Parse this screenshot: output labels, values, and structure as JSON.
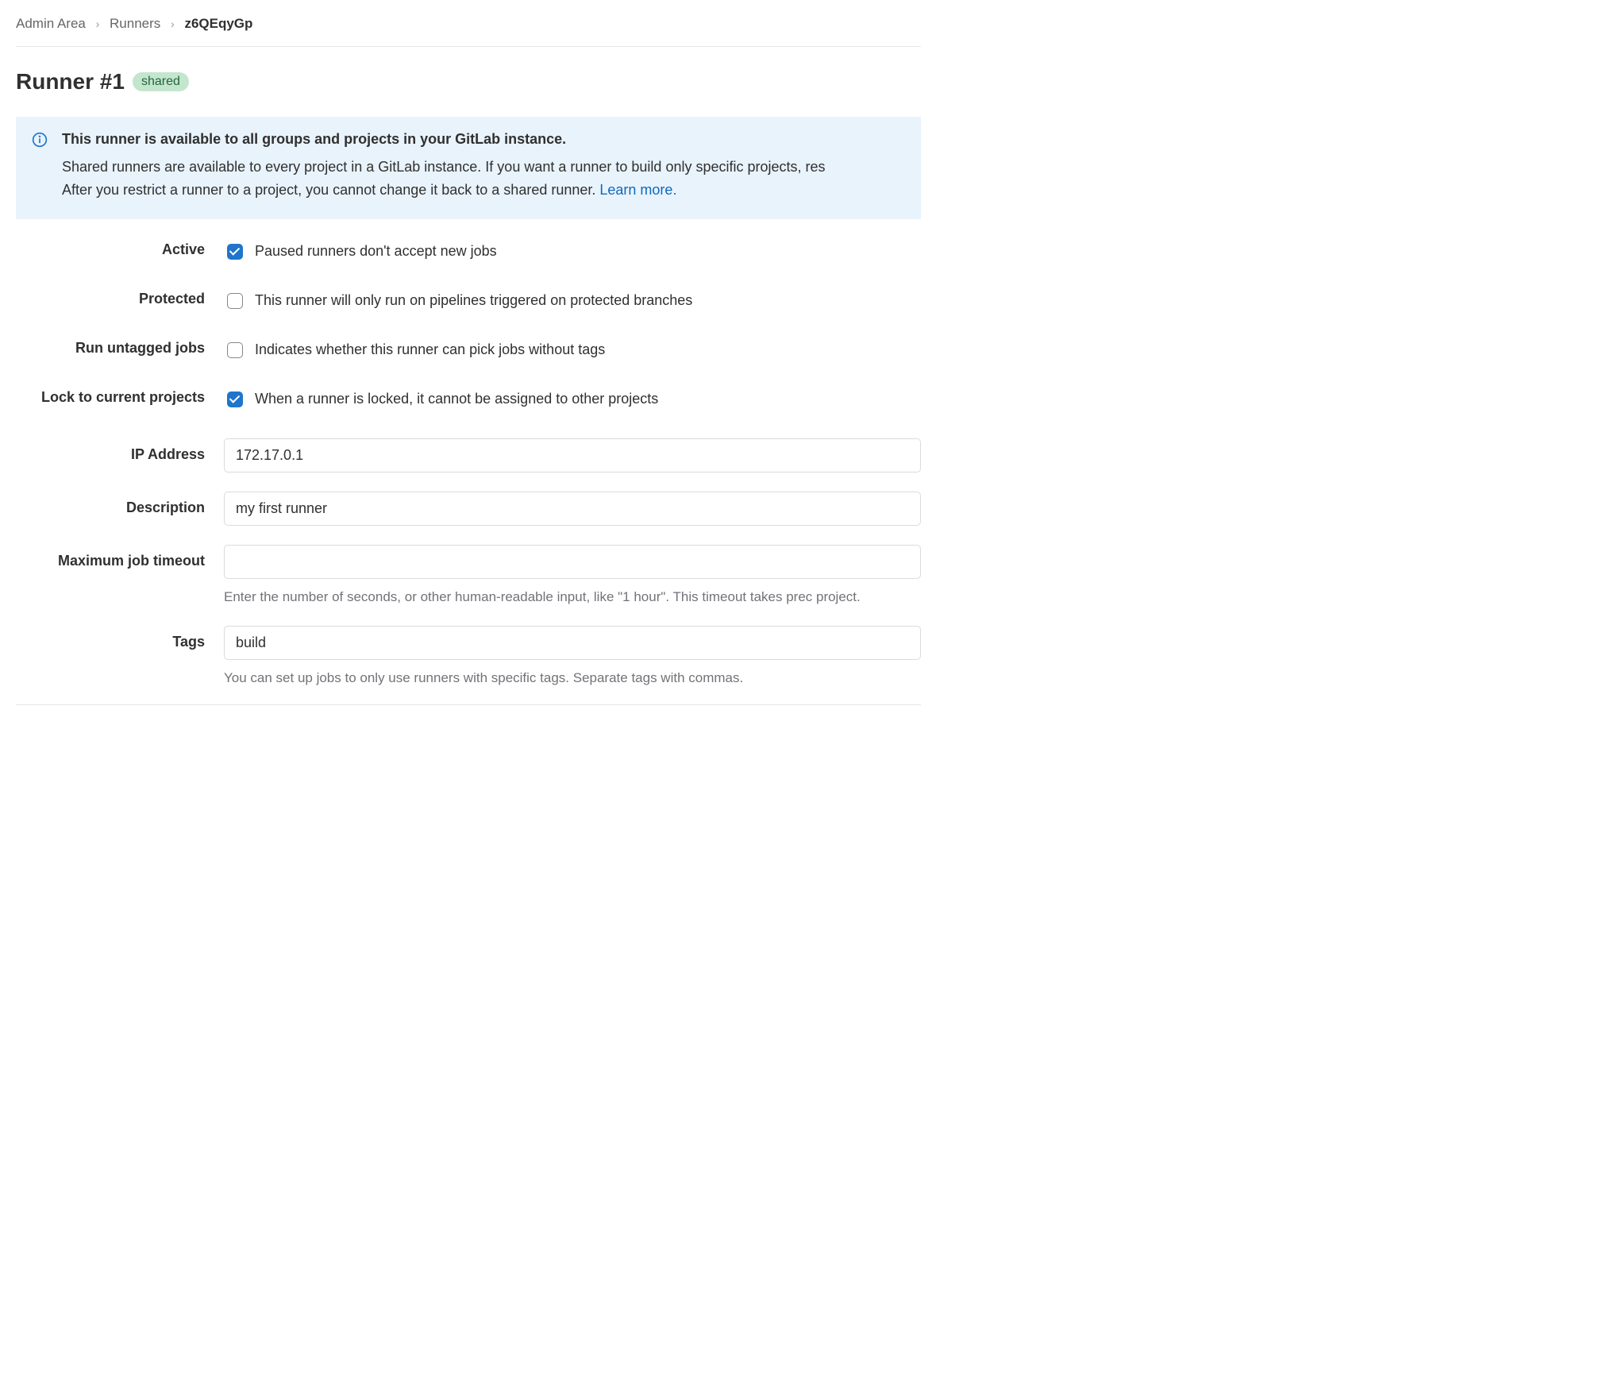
{
  "breadcrumb": {
    "items": [
      "Admin Area",
      "Runners"
    ],
    "current": "z6QEqyGp"
  },
  "header": {
    "title": "Runner #1",
    "badge": "shared"
  },
  "info": {
    "title": "This runner is available to all groups and projects in your GitLab instance.",
    "body_a": "Shared runners are available to every project in a GitLab instance. If you want a runner to build only specific projects, res",
    "body_b": "After you restrict a runner to a project, you cannot change it back to a shared runner. ",
    "learn_more": "Learn more."
  },
  "fields": {
    "active": {
      "label": "Active",
      "text": "Paused runners don't accept new jobs"
    },
    "protected": {
      "label": "Protected",
      "text": "This runner will only run on pipelines triggered on protected branches"
    },
    "untagged": {
      "label": "Run untagged jobs",
      "text": "Indicates whether this runner can pick jobs without tags"
    },
    "lock": {
      "label": "Lock to current projects",
      "text": "When a runner is locked, it cannot be assigned to other projects"
    },
    "ip": {
      "label": "IP Address",
      "value": "172.17.0.1"
    },
    "description": {
      "label": "Description",
      "value": "my first runner"
    },
    "timeout": {
      "label": "Maximum job timeout",
      "value": "",
      "help": "Enter the number of seconds, or other human-readable input, like \"1 hour\". This timeout takes prec project."
    },
    "tags": {
      "label": "Tags",
      "value": "build",
      "help": "You can set up jobs to only use runners with specific tags. Separate tags with commas."
    }
  }
}
